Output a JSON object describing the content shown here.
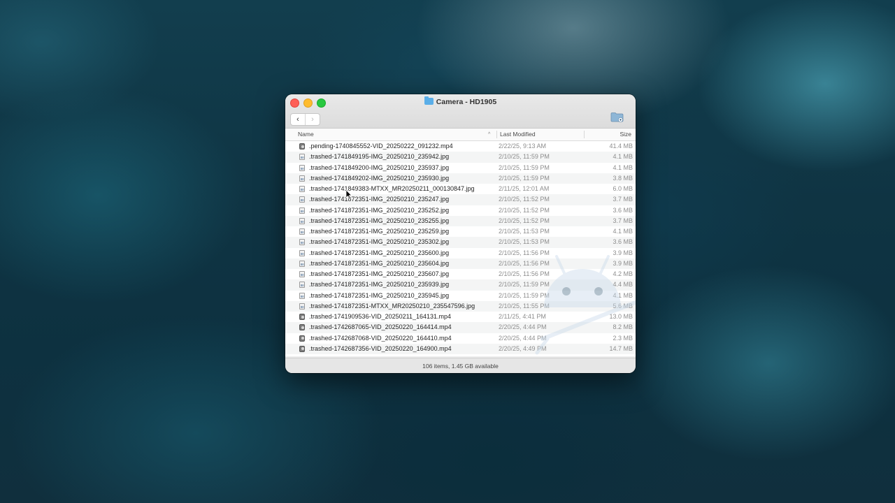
{
  "window": {
    "title": "Camera - HD1905",
    "nav": {
      "back": "‹",
      "forward": "›"
    }
  },
  "columns": {
    "name": "Name",
    "sort_indicator": "^",
    "last_modified": "Last Modified",
    "size": "Size"
  },
  "files": [
    {
      "name": ".pending-1740845552-VID_20250222_091232.mp4",
      "modified": "2/22/25, 9:13 AM",
      "size": "41.4 MB",
      "type": "vid"
    },
    {
      "name": ".trashed-1741849195-IMG_20250210_235942.jpg",
      "modified": "2/10/25, 11:59 PM",
      "size": "4.1 MB",
      "type": "img"
    },
    {
      "name": ".trashed-1741849200-IMG_20250210_235937.jpg",
      "modified": "2/10/25, 11:59 PM",
      "size": "4.1 MB",
      "type": "img"
    },
    {
      "name": ".trashed-1741849202-IMG_20250210_235930.jpg",
      "modified": "2/10/25, 11:59 PM",
      "size": "3.8 MB",
      "type": "img"
    },
    {
      "name": ".trashed-1741849383-MTXX_MR20250211_000130847.jpg",
      "modified": "2/11/25, 12:01 AM",
      "size": "6.0 MB",
      "type": "img"
    },
    {
      "name": ".trashed-1741872351-IMG_20250210_235247.jpg",
      "modified": "2/10/25, 11:52 PM",
      "size": "3.7 MB",
      "type": "img"
    },
    {
      "name": ".trashed-1741872351-IMG_20250210_235252.jpg",
      "modified": "2/10/25, 11:52 PM",
      "size": "3.6 MB",
      "type": "img"
    },
    {
      "name": ".trashed-1741872351-IMG_20250210_235255.jpg",
      "modified": "2/10/25, 11:52 PM",
      "size": "3.7 MB",
      "type": "img"
    },
    {
      "name": ".trashed-1741872351-IMG_20250210_235259.jpg",
      "modified": "2/10/25, 11:53 PM",
      "size": "4.1 MB",
      "type": "img"
    },
    {
      "name": ".trashed-1741872351-IMG_20250210_235302.jpg",
      "modified": "2/10/25, 11:53 PM",
      "size": "3.6 MB",
      "type": "img"
    },
    {
      "name": ".trashed-1741872351-IMG_20250210_235600.jpg",
      "modified": "2/10/25, 11:56 PM",
      "size": "3.9 MB",
      "type": "img"
    },
    {
      "name": ".trashed-1741872351-IMG_20250210_235604.jpg",
      "modified": "2/10/25, 11:56 PM",
      "size": "3.9 MB",
      "type": "img"
    },
    {
      "name": ".trashed-1741872351-IMG_20250210_235607.jpg",
      "modified": "2/10/25, 11:56 PM",
      "size": "4.2 MB",
      "type": "img"
    },
    {
      "name": ".trashed-1741872351-IMG_20250210_235939.jpg",
      "modified": "2/10/25, 11:59 PM",
      "size": "4.4 MB",
      "type": "img"
    },
    {
      "name": ".trashed-1741872351-IMG_20250210_235945.jpg",
      "modified": "2/10/25, 11:59 PM",
      "size": "4.1 MB",
      "type": "img"
    },
    {
      "name": ".trashed-1741872351-MTXX_MR20250210_235547596.jpg",
      "modified": "2/10/25, 11:55 PM",
      "size": "5.6 MB",
      "type": "img"
    },
    {
      "name": ".trashed-1741909536-VID_20250211_164131.mp4",
      "modified": "2/11/25, 4:41 PM",
      "size": "13.0 MB",
      "type": "vid"
    },
    {
      "name": ".trashed-1742687065-VID_20250220_164414.mp4",
      "modified": "2/20/25, 4:44 PM",
      "size": "8.2 MB",
      "type": "vid"
    },
    {
      "name": ".trashed-1742687068-VID_20250220_164410.mp4",
      "modified": "2/20/25, 4:44 PM",
      "size": "2.3 MB",
      "type": "vid"
    },
    {
      "name": ".trashed-1742687356-VID_20250220_164900.mp4",
      "modified": "2/20/25, 4:49 PM",
      "size": "14.7 MB",
      "type": "vid"
    }
  ],
  "status": {
    "text": "106 items, 1.45 GB available"
  },
  "icons": {
    "folder": "folder-icon",
    "new_folder": "new-folder-icon",
    "android": "android-icon",
    "video_file": "video-file-icon",
    "image_file": "image-file-icon"
  },
  "colors": {
    "close": "#fe5f57",
    "minimize": "#febc2e",
    "maximize": "#28c840",
    "folder_accent": "#5aaee8"
  }
}
